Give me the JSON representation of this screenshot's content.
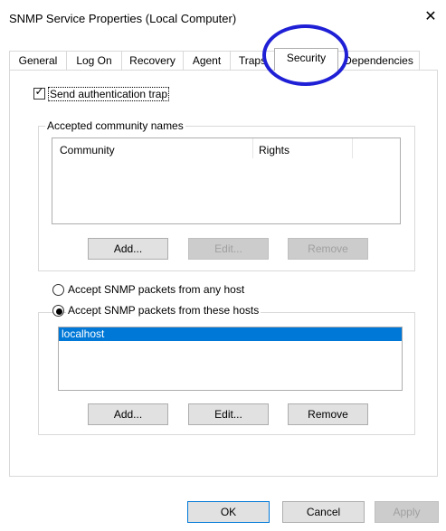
{
  "window": {
    "title": "SNMP Service Properties (Local Computer)",
    "close_glyph": "✕"
  },
  "tabs": [
    "General",
    "Log On",
    "Recovery",
    "Agent",
    "Traps",
    "Security",
    "Dependencies"
  ],
  "active_tab": "Security",
  "auth_trap": {
    "label": "Send authentication trap",
    "checked": true
  },
  "community": {
    "group_label": "Accepted community names",
    "columns": [
      "Community",
      "Rights"
    ],
    "rows": [],
    "buttons": {
      "add": "Add...",
      "edit": "Edit...",
      "remove": "Remove"
    }
  },
  "hosts": {
    "option_any": "Accept SNMP packets from any host",
    "option_these": "Accept SNMP packets from these hosts",
    "selected_option": "these",
    "list": [
      "localhost"
    ],
    "buttons": {
      "add": "Add...",
      "edit": "Edit...",
      "remove": "Remove"
    }
  },
  "footer": {
    "ok": "OK",
    "cancel": "Cancel",
    "apply": "Apply"
  },
  "colors": {
    "accent": "#0078d7",
    "annotation_circle": "#1f20d6"
  }
}
